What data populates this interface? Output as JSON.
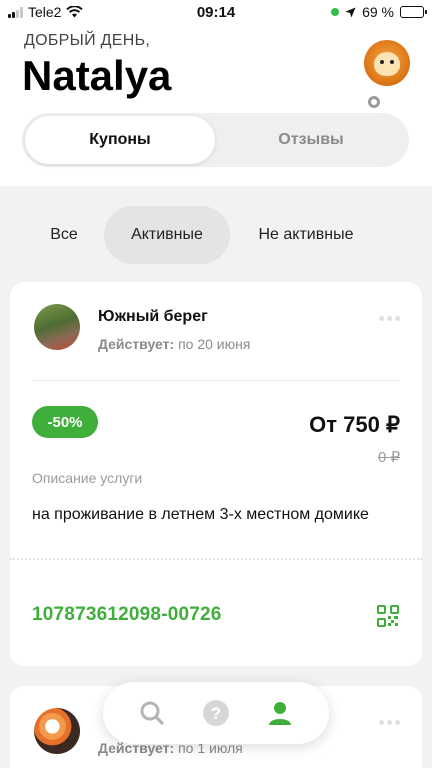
{
  "status_bar": {
    "carrier": "Tele2",
    "time": "09:14",
    "battery_percent": "69 %"
  },
  "header": {
    "greeting": "ДОБРЫЙ ДЕНЬ,",
    "user_name": "Natalya",
    "segments": [
      {
        "label": "Купоны",
        "active": true
      },
      {
        "label": "Отзывы",
        "active": false
      }
    ]
  },
  "filters": [
    {
      "label": "Все",
      "active": false
    },
    {
      "label": "Активные",
      "active": true
    },
    {
      "label": "Не активные",
      "active": false
    }
  ],
  "coupons": [
    {
      "shop": "Южный берег",
      "valid_label": "Действует:",
      "valid_until": "по 20 июня",
      "discount": "-50%",
      "price": "От 750 ₽",
      "old_price": "0 ₽",
      "description_label": "Описание услуги",
      "description": "на проживание в летнем 3-х местном домике",
      "code": "107873612098-00726"
    },
    {
      "shop": "",
      "valid_label": "Действует:",
      "valid_until": "по 1 июля"
    }
  ],
  "colors": {
    "accent_green": "#3fae3b",
    "background": "#f2f2f2"
  },
  "bottom_nav": {
    "items": [
      {
        "icon": "search-icon"
      },
      {
        "icon": "help-icon"
      },
      {
        "icon": "profile-icon",
        "active": true
      }
    ]
  }
}
